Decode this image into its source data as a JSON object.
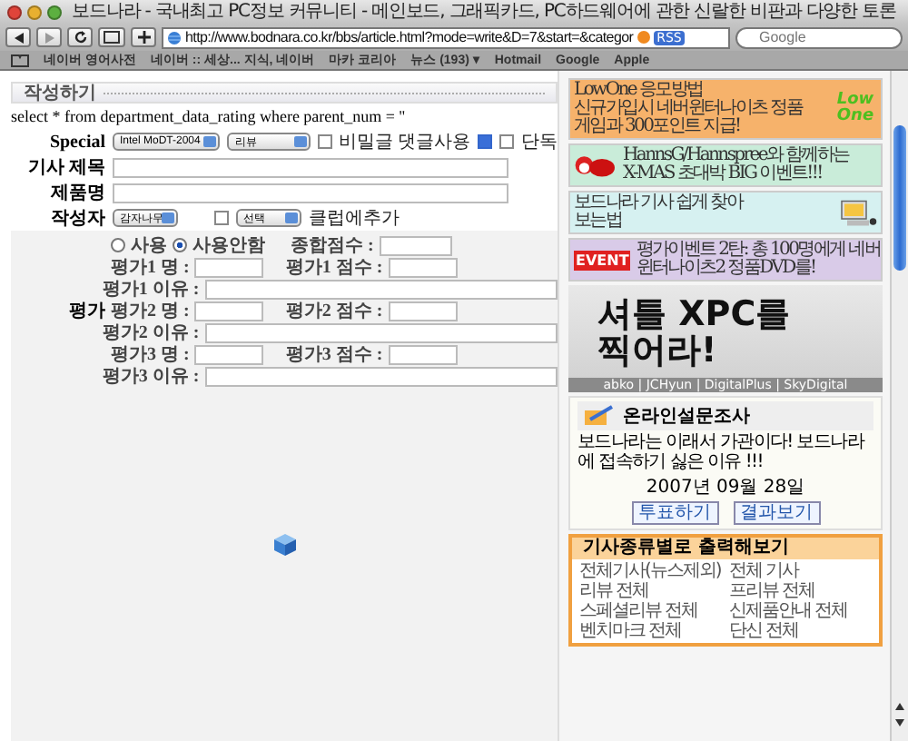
{
  "window": {
    "title": "보드나라 - 국내최고 PC정보 커뮤니티 - 메인보드, 그래픽카드, PC하드웨어에 관한 신랄한 비판과 다양한 토론"
  },
  "toolbar": {
    "url": "http://www.bodnara.co.kr/bbs/article.html?mode=write&D=7&start=&categor",
    "rss": "RSS",
    "search": {
      "placeholder": "Google"
    }
  },
  "bookmarks": [
    {
      "label": "네이버 영어사전"
    },
    {
      "label": "네이버 :: 세상... 지식, 네이버"
    },
    {
      "label": "마카 코리아"
    },
    {
      "label": "뉴스 (193) ▾"
    },
    {
      "label": "Hotmail"
    },
    {
      "label": "Google"
    },
    {
      "label": "Apple"
    }
  ],
  "form": {
    "heading": "작성하기",
    "query": "select * from department_data_rating where parent_num = ''",
    "special": {
      "label": "Special",
      "selects": [
        "Intel MoDT-2004",
        "리뷰"
      ],
      "checks": [
        {
          "label": "비밀글 댓글사용",
          "checked": false
        },
        {
          "checked": true
        },
        {
          "label": "단독",
          "checked": false
        }
      ]
    },
    "fields": [
      {
        "label": "기사 제목"
      },
      {
        "label": "제품명"
      }
    ],
    "author": {
      "label": "작성자",
      "select": "감자나무",
      "check": {
        "checked": false
      },
      "club_select": "선택",
      "club_label": "클럽에추가"
    },
    "evaluation": [
      {
        "kind": "radio",
        "options": [
          {
            "label": "사용",
            "selected": false
          },
          {
            "label": "사용안함",
            "selected": true
          }
        ],
        "field_label": "종합점수 :"
      },
      {
        "kind": "pair",
        "name_label": "평가1 명 :",
        "score_label": "평가1 점수 :"
      },
      {
        "kind": "reason",
        "field_label": "평가1 이유 :"
      },
      {
        "kind": "pair",
        "label": "평가",
        "name_label": "평가2 명 :",
        "score_label": "평가2 점수 :"
      },
      {
        "kind": "reason",
        "field_label": "평가2 이유 :"
      },
      {
        "kind": "pair",
        "name_label": "평가3 명 :",
        "score_label": "평가3 점수 :"
      },
      {
        "kind": "reason",
        "field_label": "평가3 이유 :"
      }
    ]
  },
  "sidebar": {
    "banners": [
      {
        "kind": "logo",
        "color": "#f6b26b",
        "art_text": "Low One",
        "lines": [
          "LowOne 응모방법",
          "신규가입시 네버윈터나이츠 정품",
          "게임과 300포인트 지급!"
        ]
      },
      {
        "kind": "santa",
        "color": "#c9ecd9",
        "lines": [
          "HannsG/Hannspree와 함께하는",
          "X-MAS 초대박 BIG 이벤트!!!"
        ]
      },
      {
        "kind": "computer",
        "color": "#d6f1f1",
        "lines": [
          "보드나라 기사 쉽게 찾아",
          "보는법"
        ]
      },
      {
        "kind": "event",
        "color": "#d9cbe8",
        "art_text": "EVENT",
        "lines": [
          "평가이벤트 2탄: 총 100명에게 네버",
          "윈터나이츠2 정품DVD를!"
        ]
      }
    ],
    "ad": {
      "headline": [
        "셔틀 XPC를",
        "찍어라!"
      ],
      "caption": "abko | JCHyun | DigitalPlus | SkyDigital"
    },
    "poll": {
      "title": "온라인설문조사",
      "question": "보드나라는 이래서 가관이다! 보드나라에 접속하기 싫은 이유 !!!",
      "date": "2007년 09월 28일",
      "buttons": [
        "투표하기",
        "결과보기"
      ]
    },
    "categories": {
      "title": "기사종류별로 출력해보기",
      "items": [
        "전체기사(뉴스제외)",
        "전체 기사",
        "리뷰 전체",
        "프리뷰 전체",
        "스페셜리뷰 전체",
        "신제품안내 전체",
        "벤치마크 전체",
        "단신 전체"
      ]
    }
  }
}
